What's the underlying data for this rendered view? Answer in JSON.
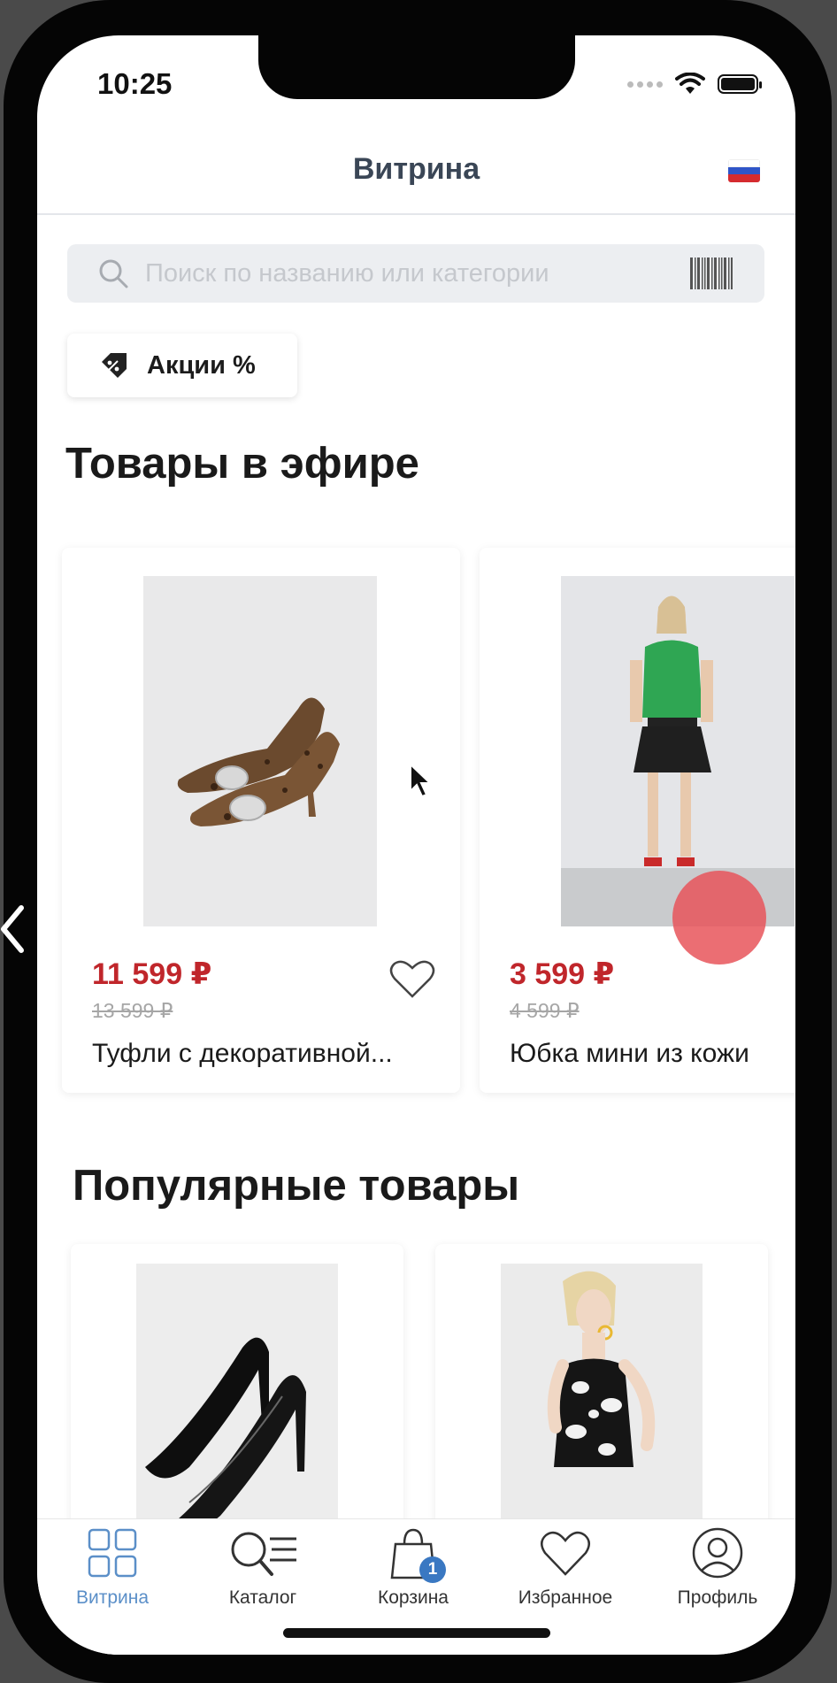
{
  "status_bar": {
    "time": "10:25"
  },
  "header": {
    "title": "Витрина",
    "flag": "flag-russia-icon"
  },
  "search": {
    "placeholder": "Поиск по названию или категории",
    "scan_icon": "barcode-icon"
  },
  "promo": {
    "label": "Акции %"
  },
  "live_section": {
    "title": "Товары в эфире",
    "products": [
      {
        "price": "11 599 ₽",
        "old_price": "13 599 ₽",
        "name": "Туфли с декоративной..."
      },
      {
        "price": "3 599 ₽",
        "old_price": "4 599 ₽",
        "name": "Юбка мини из кожи"
      }
    ]
  },
  "popular_section": {
    "title": "Популярные товары"
  },
  "tabbar": {
    "items": [
      {
        "label": "Витрина",
        "icon": "grid-icon",
        "active": true
      },
      {
        "label": "Каталог",
        "icon": "catalog-search-icon"
      },
      {
        "label": "Корзина",
        "icon": "cart-bag-icon",
        "badge": "1"
      },
      {
        "label": "Избранное",
        "icon": "heart-icon"
      },
      {
        "label": "Профиль",
        "icon": "profile-icon"
      }
    ]
  },
  "colors": {
    "price": "#c0262b",
    "accent": "#5b8fc8",
    "badge": "#3a78c2"
  }
}
